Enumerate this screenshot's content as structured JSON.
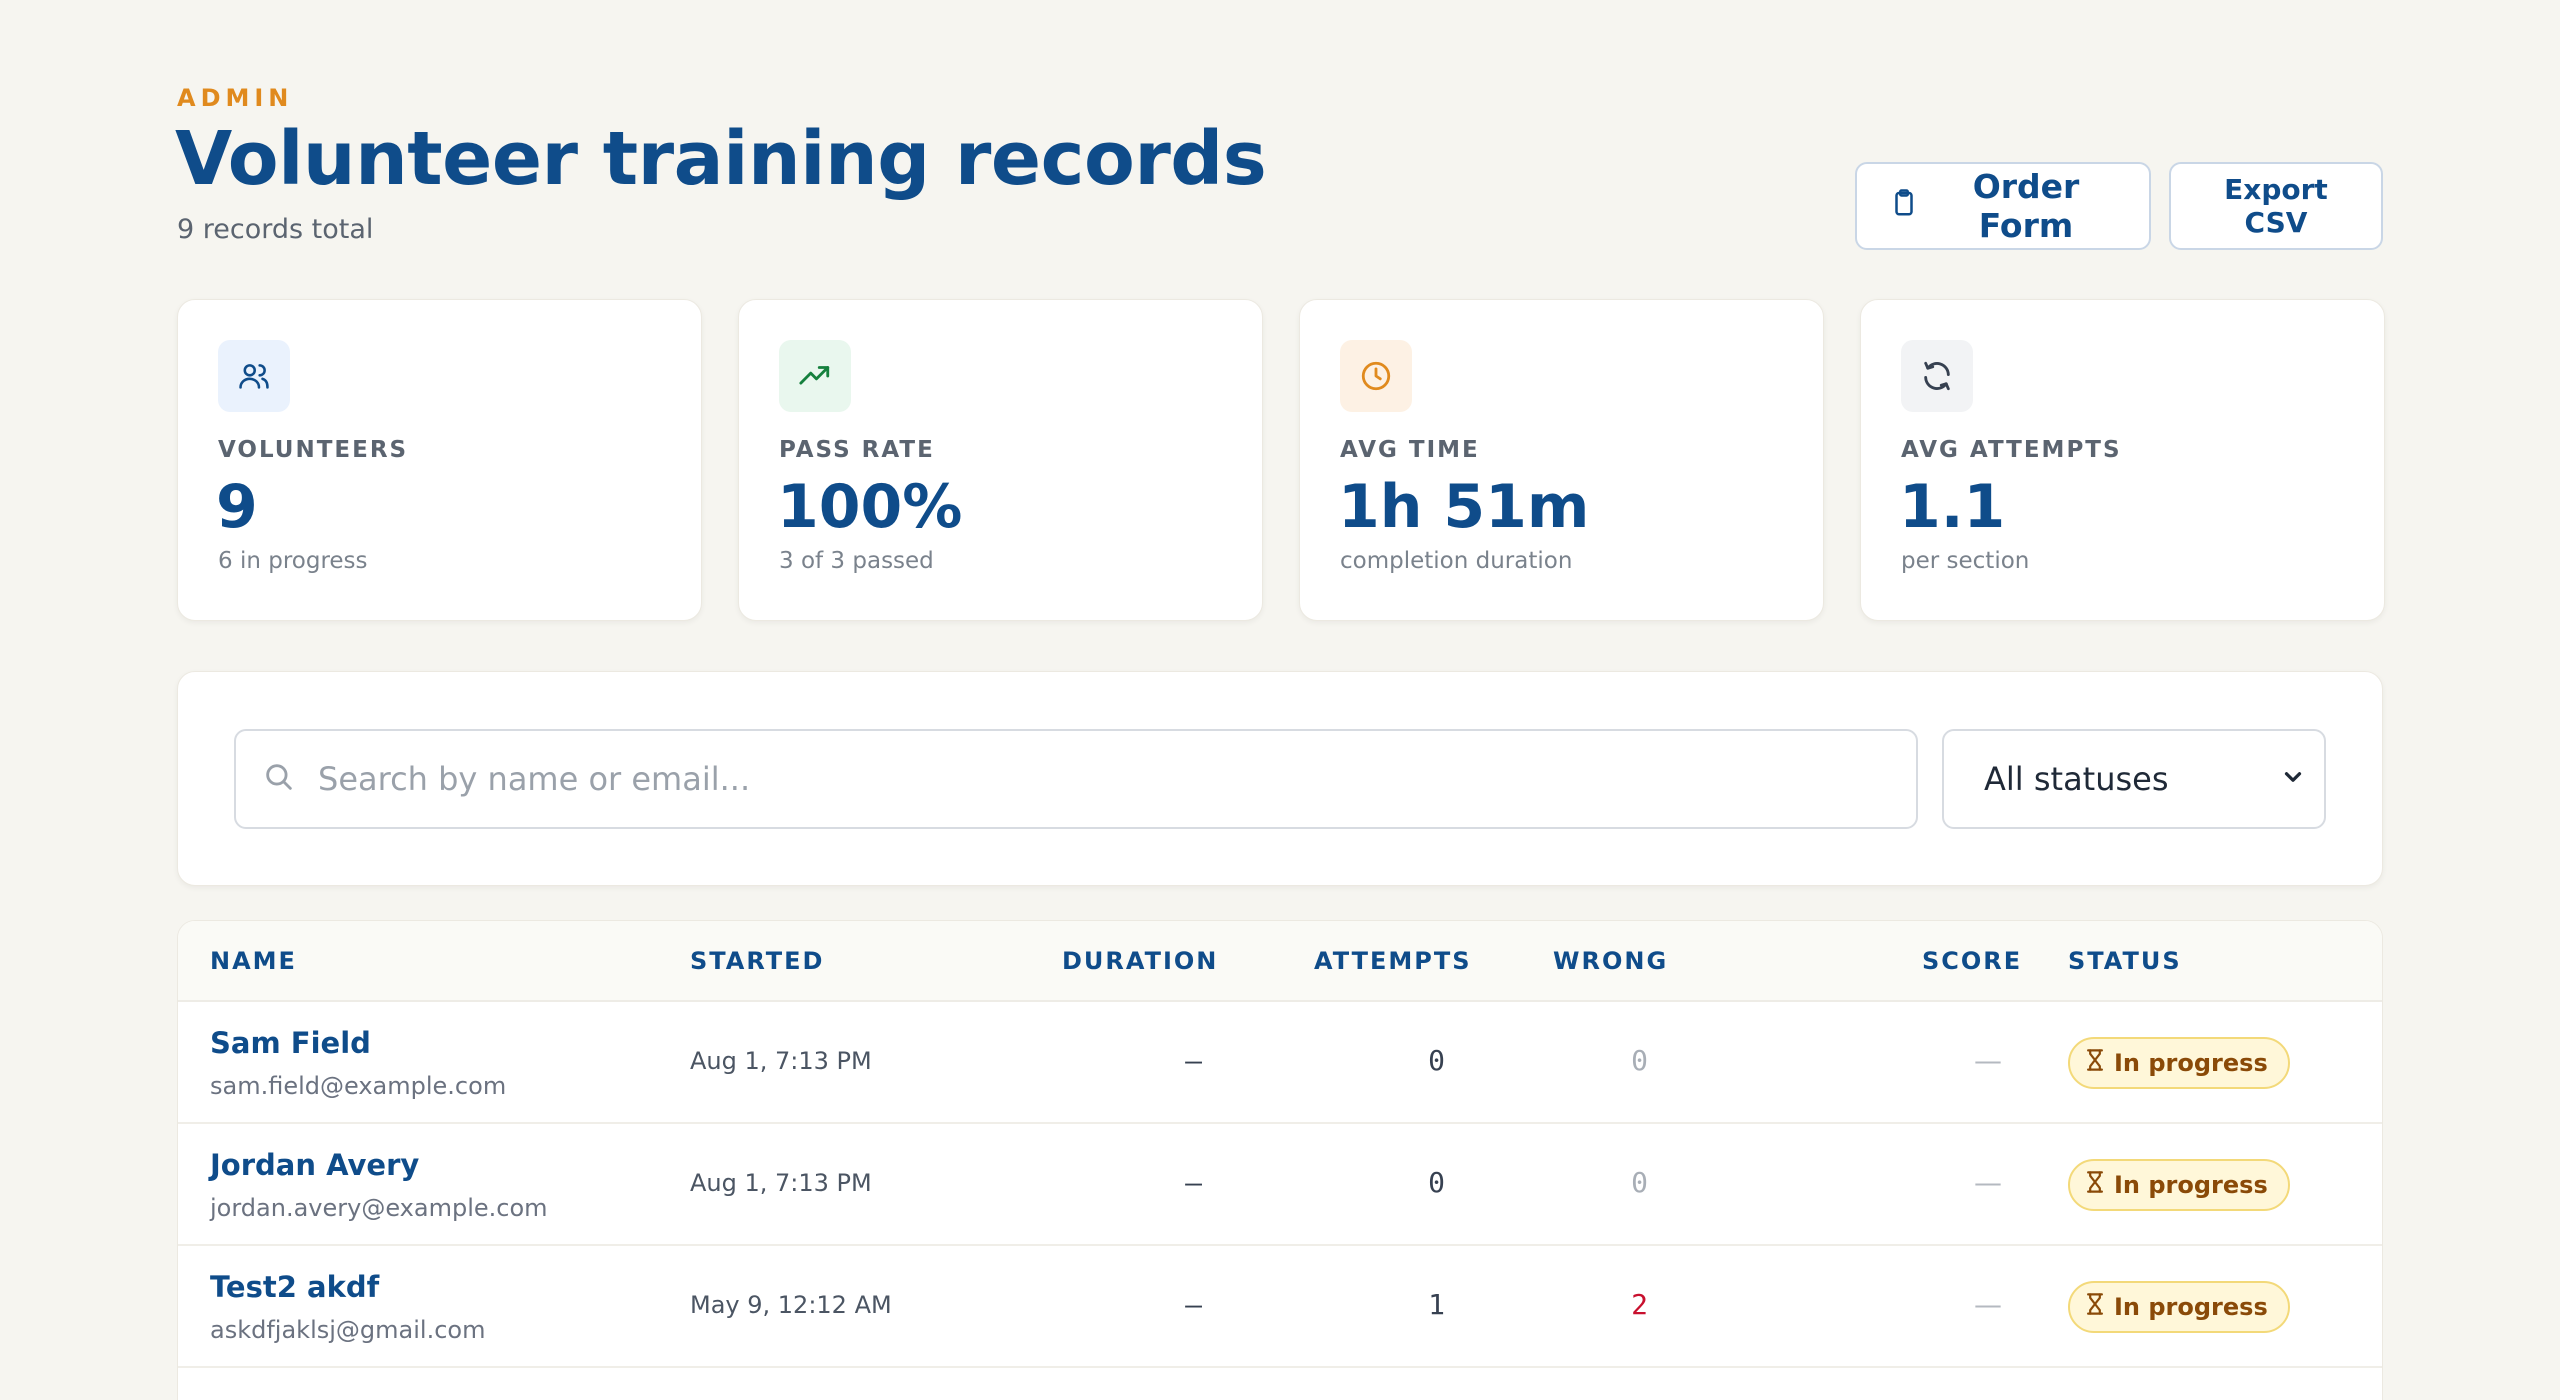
{
  "header": {
    "eyebrow": "ADMIN",
    "title": "Volunteer training records",
    "subtitle": "9 records total",
    "order_form_label": "Order Form",
    "export_label": "Export CSV"
  },
  "stats": [
    {
      "label": "VOLUNTEERS",
      "value": "9",
      "sub": "6 in progress",
      "icon": "users-icon",
      "icon_bg": "#eaf2fd",
      "icon_color": "#0f4c8a"
    },
    {
      "label": "PASS RATE",
      "value": "100%",
      "sub": "3 of 3 passed",
      "icon": "trending-up-icon",
      "icon_bg": "#e9f7ee",
      "icon_color": "#15803d"
    },
    {
      "label": "AVG TIME",
      "value": "1h 51m",
      "sub": "completion duration",
      "icon": "clock-icon",
      "icon_bg": "#fdf1e4",
      "icon_color": "#e08a1e"
    },
    {
      "label": "AVG ATTEMPTS",
      "value": "1.1",
      "sub": "per section",
      "icon": "refresh-icon",
      "icon_bg": "#f2f3f5",
      "icon_color": "#374151"
    }
  ],
  "filters": {
    "search_placeholder": "Search by name or email...",
    "status_selected": "All statuses"
  },
  "table": {
    "columns": {
      "name": "NAME",
      "started": "STARTED",
      "duration": "DURATION",
      "attempts": "ATTEMPTS",
      "wrong": "WRONG",
      "score": "SCORE",
      "status": "STATUS"
    },
    "rows": [
      {
        "name": "Sam Field",
        "email": "sam.field@example.com",
        "started": "Aug 1, 7:13 PM",
        "duration": "–",
        "attempts": "0",
        "wrong": "0",
        "score": "—",
        "status": "In progress"
      },
      {
        "name": "Jordan Avery",
        "email": "jordan.avery@example.com",
        "started": "Aug 1, 7:13 PM",
        "duration": "–",
        "attempts": "0",
        "wrong": "0",
        "score": "—",
        "status": "In progress"
      },
      {
        "name": "Test2 akdf",
        "email": "askdfjaklsj@gmail.com",
        "started": "May 9, 12:12 AM",
        "duration": "–",
        "attempts": "1",
        "wrong": "2",
        "score": "—",
        "status": "In progress"
      }
    ]
  }
}
